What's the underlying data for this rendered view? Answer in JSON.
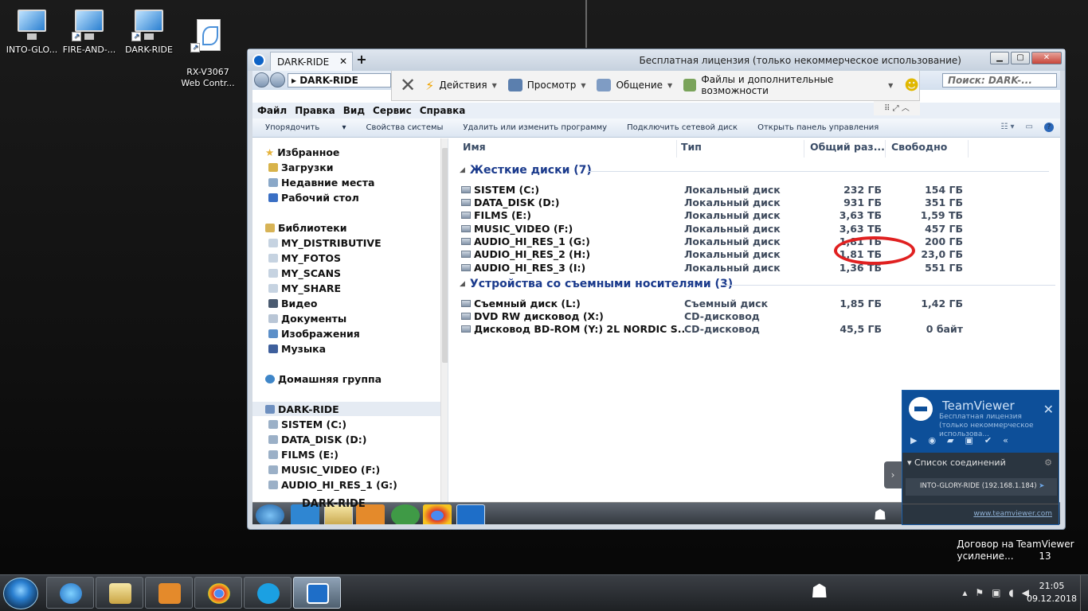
{
  "desktop": {
    "icons": [
      {
        "label": "INTO-GLO..."
      },
      {
        "label": "FIRE-AND-..."
      },
      {
        "label": "DARK-RIDE"
      },
      {
        "label": "RX-V3067\nWeb Contr..."
      }
    ],
    "right_icons": [
      {
        "label": "Договор на\nусиление..."
      },
      {
        "label": "TeamViewer\n13"
      }
    ]
  },
  "tv_window": {
    "tab_label": "DARK-RIDE",
    "license_text": "Бесплатная лицензия (только некоммерческое использование)",
    "toolbar": {
      "actions": "Действия",
      "view": "Просмотр",
      "communicate": "Общение",
      "files": "Файлы и дополнительные возможности"
    }
  },
  "explorer": {
    "address": "DARK-RIDE",
    "search_placeholder": "Поиск: DARK-...",
    "menu": [
      "Файл",
      "Правка",
      "Вид",
      "Сервис",
      "Справка"
    ],
    "commands": [
      "Упорядочить",
      "Свойства системы",
      "Удалить или изменить программу",
      "Подключить сетевой диск",
      "Открыть панель управления"
    ],
    "nav": {
      "favorites": "Избранное",
      "favorites_items": [
        "Загрузки",
        "Недавние места",
        "Рабочий стол"
      ],
      "libraries": "Библиотеки",
      "library_items": [
        "MY_DISTRIBUTIVE",
        "MY_FOTOS",
        "MY_SCANS",
        "MY_SHARE",
        "Видео",
        "Документы",
        "Изображения",
        "Музыка"
      ],
      "homegroup": "Домашняя группа",
      "computer": "DARK-RIDE",
      "computer_items": [
        "SISTEM (C:)",
        "DATA_DISK (D:)",
        "FILMS (E:)",
        "MUSIC_VIDEO (F:)",
        "AUDIO_HI_RES_1 (G:)"
      ]
    },
    "columns": {
      "name": "Имя",
      "type": "Тип",
      "total": "Общий раз...",
      "free": "Свободно"
    },
    "groups": [
      {
        "title": "Жесткие диски (7)",
        "rows": [
          {
            "name": "SISTEM (C:)",
            "type": "Локальный диск",
            "total": "232 ГБ",
            "free": "154 ГБ"
          },
          {
            "name": "DATA_DISK (D:)",
            "type": "Локальный диск",
            "total": "931 ГБ",
            "free": "351 ГБ"
          },
          {
            "name": "FILMS (E:)",
            "type": "Локальный диск",
            "total": "3,63 ТБ",
            "free": "1,59 ТБ"
          },
          {
            "name": "MUSIC_VIDEO (F:)",
            "type": "Локальный диск",
            "total": "3,63 ТБ",
            "free": "457 ГБ"
          },
          {
            "name": "AUDIO_HI_RES_1 (G:)",
            "type": "Локальный диск",
            "total": "1,81 ТБ",
            "free": "200 ГБ"
          },
          {
            "name": "AUDIO_HI_RES_2 (H:)",
            "type": "Локальный диск",
            "total": "1,81 ТБ",
            "free": "23,0 ГБ"
          },
          {
            "name": "AUDIO_HI_RES_3 (I:)",
            "type": "Локальный диск",
            "total": "1,36 ТБ",
            "free": "551 ГБ"
          }
        ]
      },
      {
        "title": "Устройства со съемными носителями (3)",
        "rows": [
          {
            "name": "Съемный диск (L:)",
            "type": "Съемный диск",
            "total": "1,85 ГБ",
            "free": "1,42 ГБ"
          },
          {
            "name": "DVD RW дисковод (X:)",
            "type": "CD-дисковод",
            "total": "",
            "free": ""
          },
          {
            "name": "Дисковод BD-ROM (Y:) 2L NORDIC S...",
            "type": "CD-дисковод",
            "total": "45,5 ГБ",
            "free": "0 байт"
          }
        ]
      }
    ],
    "status_name": "DARK-RIDE"
  },
  "tv_panel": {
    "title": "TeamViewer",
    "subtitle": "Бесплатная лицензия (только некоммерческое использова...",
    "list_header": "Список соединений",
    "connection": "INTO-GLORY-RIDE (192.168.1.184)",
    "link": "www.teamviewer.com"
  },
  "taskbar": {
    "time": "21:05",
    "date": "09.12.2018"
  },
  "colors": {
    "highlight_ring": "#e02020",
    "tv_blue": "#0d4f99",
    "group_title": "#1a3a8c"
  }
}
